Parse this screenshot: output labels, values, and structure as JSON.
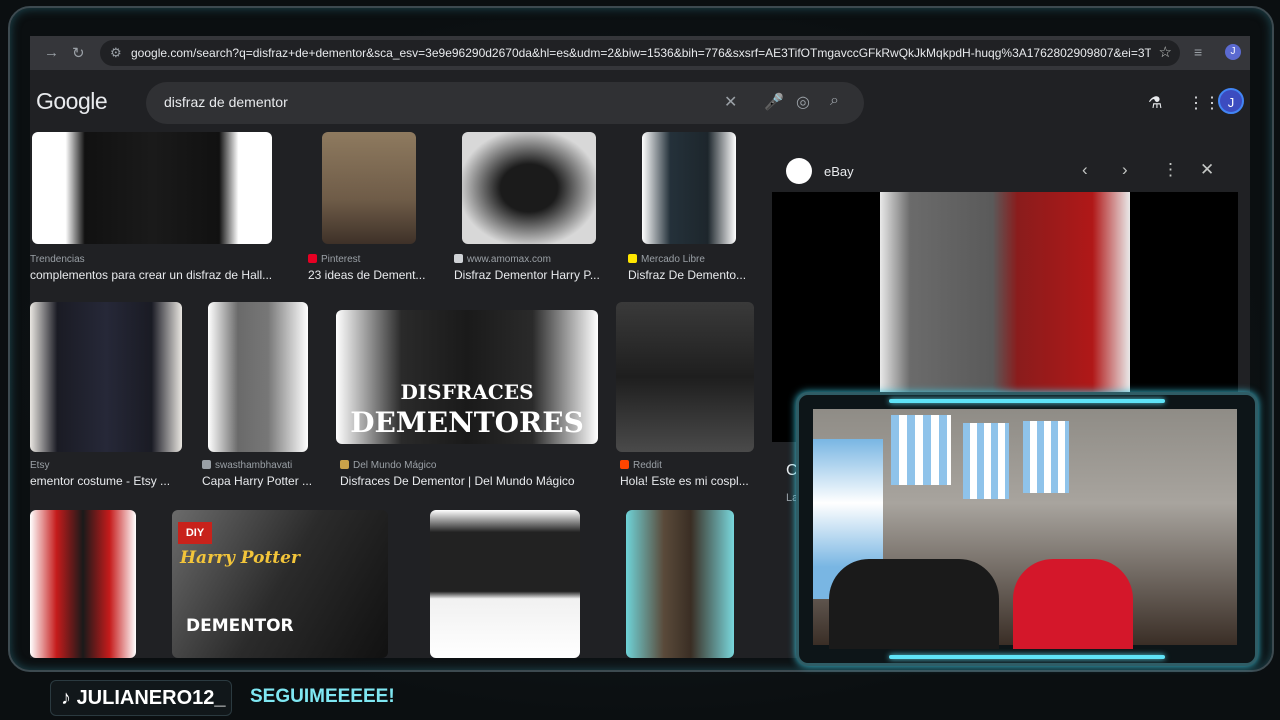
{
  "browser": {
    "url": "google.com/search?q=disfraz+de+dementor&sca_esv=3e9e96290d2670da&hl=es&udm=2&biw=1536&bih=776&sxsrf=AE3TifOTmgavccGFkRwQkJkMqkpdH-huqg%3A1762802909807&ei=3Tw...",
    "profile_initial": "J"
  },
  "google": {
    "logo": "Google",
    "query": "disfraz de dementor",
    "avatar_initial": "J"
  },
  "results": [
    {
      "source": "Trendencias",
      "title": "complementos para crear un disfraz de Hall..."
    },
    {
      "source": "Pinterest",
      "title": "23 ideas de Dement..."
    },
    {
      "source": "www.amomax.com",
      "title": "Disfraz Dementor Harry P..."
    },
    {
      "source": "Mercado Libre",
      "title": "Disfraz De Demento..."
    },
    {
      "source": "Etsy",
      "title": "ementor costume - Etsy ..."
    },
    {
      "source": "swasthambhavati",
      "title": "Capa Harry Potter ..."
    },
    {
      "source": "Del Mundo Mágico",
      "title": "Disfraces De Dementor | Del Mundo Mágico"
    },
    {
      "source": "Reddit",
      "title": "Hola! Este es mi cospl..."
    }
  ],
  "thumb_text": {
    "disfraces_line1": "DISFRACES",
    "disfraces_line2": "DEMENTORES",
    "diy": "DIY",
    "harry_potter": "Harry Potter",
    "dementor": "DEMENTOR"
  },
  "panel": {
    "source": "eBay",
    "peek_title": "C",
    "peek_sub": "La"
  },
  "overlay": {
    "channel": "JULIANERO12_",
    "cta": "SEGUIMEEEEE!"
  },
  "colors": {
    "accent": "#5fe3f7",
    "page_bg": "#202124"
  }
}
